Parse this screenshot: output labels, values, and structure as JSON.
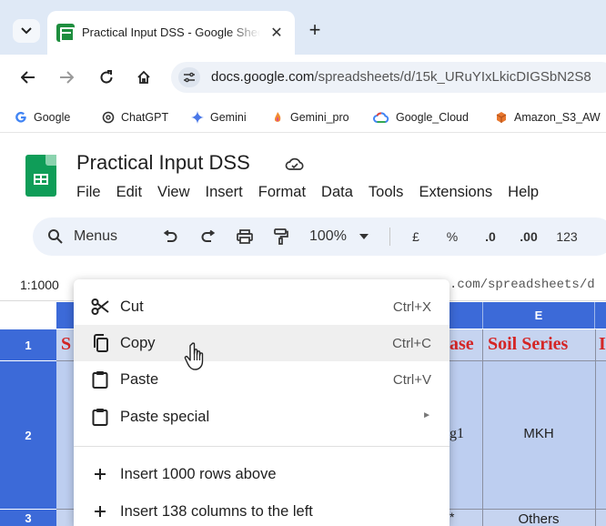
{
  "browser": {
    "tab": {
      "title": "Practical Input DSS - Google Sheets",
      "close": "✕"
    },
    "new_tab": "+",
    "url": {
      "host": "docs.google.com",
      "path": "/spreadsheets/d/15k_URuYIxLkicDIGSbN2S8"
    },
    "bookmarks": [
      {
        "label": "Google",
        "icon": "google-icon"
      },
      {
        "label": "ChatGPT",
        "icon": "chatgpt-icon"
      },
      {
        "label": "Gemini",
        "icon": "gemini-icon"
      },
      {
        "label": "Gemini_pro",
        "icon": "gemini-pro-icon"
      },
      {
        "label": "Google_Cloud",
        "icon": "google-cloud-icon"
      },
      {
        "label": "Amazon_S3_AW",
        "icon": "amazon-s3-icon"
      }
    ]
  },
  "sheets": {
    "doc_title": "Practical Input DSS",
    "menus": [
      "File",
      "Edit",
      "View",
      "Insert",
      "Format",
      "Data",
      "Tools",
      "Extensions",
      "Help"
    ],
    "toolbar": {
      "search_label": "Menus",
      "zoom": "100%",
      "currency": "£",
      "percent": "%",
      "decrease_decimal": ".0",
      "increase_decimal": ".00",
      "number_format": "123"
    },
    "name_box": "1:1000",
    "formula_visible": ".com/spreadsheets/d"
  },
  "grid": {
    "column_e_header": "E",
    "row_numbers": [
      "1",
      "2",
      "3"
    ],
    "row1": {
      "left_fragment": "S",
      "d_fragment": "ase",
      "e_value": "Soil Series",
      "f_fragment": "I"
    },
    "row2": {
      "d_fragment": "g1",
      "e_value": "MKH"
    },
    "row3": {
      "d_fragment": "*",
      "e_value": "Others"
    }
  },
  "context_menu": {
    "items": [
      {
        "label": "Cut",
        "shortcut": "Ctrl+X",
        "icon": "scissors-icon"
      },
      {
        "label": "Copy",
        "shortcut": "Ctrl+C",
        "icon": "copy-icon"
      },
      {
        "label": "Paste",
        "shortcut": "Ctrl+V",
        "icon": "clipboard-icon"
      },
      {
        "label": "Paste special",
        "icon": "clipboard-icon"
      },
      {
        "label": "Insert 1000 rows above",
        "icon": "plus-icon"
      },
      {
        "label": "Insert 138 columns to the left",
        "icon": "plus-icon"
      }
    ]
  },
  "colors": {
    "header_blue": "#3c6ad8",
    "selection_fill": "#c6d4f0",
    "title_red": "#d42626",
    "tabbar_bg": "#dfe9f6",
    "sheets_green": "#0f9d58"
  }
}
